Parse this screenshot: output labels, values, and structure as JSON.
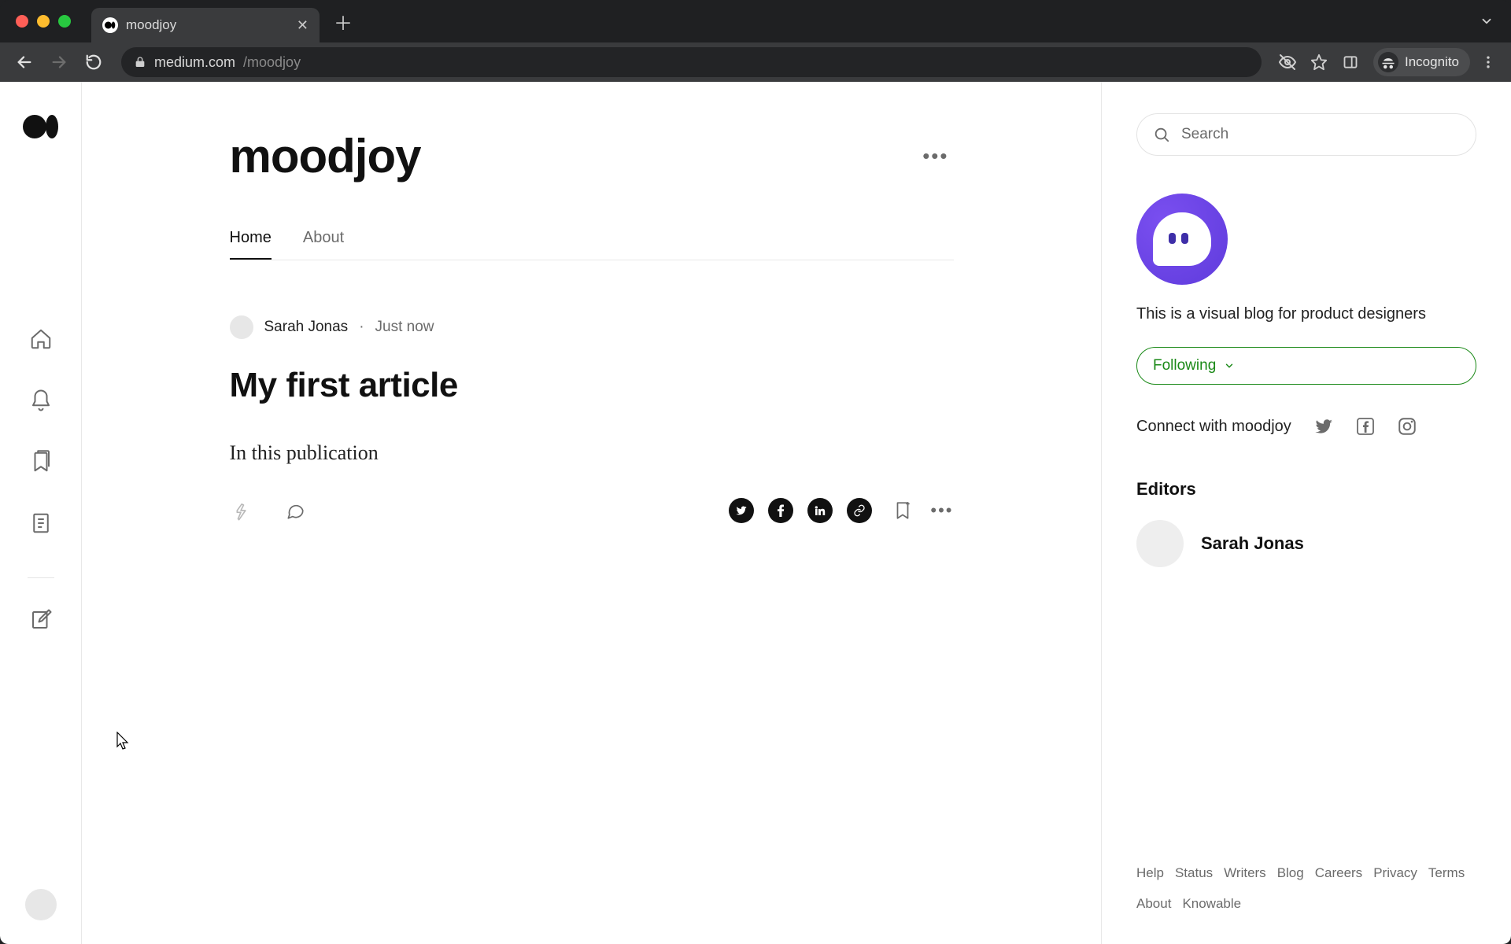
{
  "browser": {
    "tab_title": "moodjoy",
    "url_host": "medium.com",
    "url_path": "/moodjoy",
    "incognito_label": "Incognito"
  },
  "sidebar": {
    "items": [
      "home",
      "notifications",
      "bookmarks",
      "stories",
      "write"
    ]
  },
  "publication": {
    "title": "moodjoy",
    "tabs": [
      {
        "label": "Home",
        "active": true
      },
      {
        "label": "About",
        "active": false
      }
    ]
  },
  "post": {
    "author": "Sarah Jonas",
    "time": "Just now",
    "title": "My first article",
    "excerpt": "In this publication"
  },
  "rail": {
    "search_placeholder": "Search",
    "description": "This is a visual blog for product designers",
    "follow_label": "Following",
    "connect_label": "Connect with moodjoy",
    "editors_heading": "Editors",
    "editors": [
      {
        "name": "Sarah Jonas"
      }
    ],
    "footer": [
      "Help",
      "Status",
      "Writers",
      "Blog",
      "Careers",
      "Privacy",
      "Terms",
      "About",
      "Knowable"
    ]
  }
}
